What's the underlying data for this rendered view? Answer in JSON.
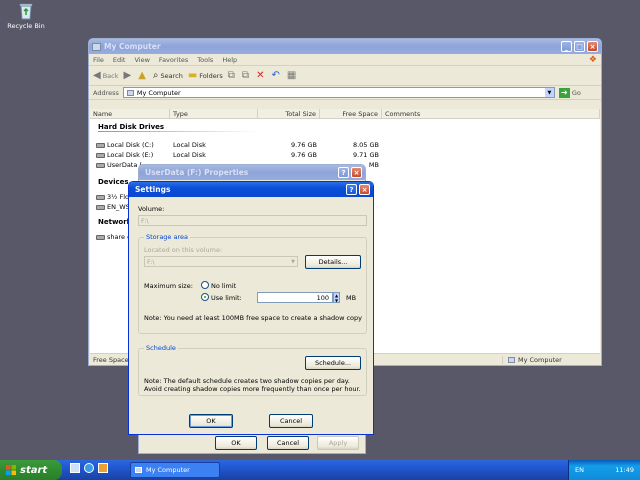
{
  "desktop": {
    "recycle_bin_label": "Recycle Bin"
  },
  "explorer": {
    "title": "My Computer",
    "menu": [
      "File",
      "Edit",
      "View",
      "Favorites",
      "Tools",
      "Help"
    ],
    "toolbar": {
      "back": "Back",
      "search": "Search",
      "folders": "Folders"
    },
    "address_label": "Address",
    "address_value": "My Computer",
    "go_label": "Go",
    "columns": [
      "Name",
      "Type",
      "Total Size",
      "Free Space",
      "Comments"
    ],
    "groups": {
      "hard_disks": "Hard Disk Drives",
      "devices": "Devices",
      "network": "Network"
    },
    "drives": [
      {
        "name": "Local Disk (C:)",
        "type": "Local Disk",
        "total": "9.76 GB",
        "free": "8.05 GB"
      },
      {
        "name": "Local Disk (E:)",
        "type": "Local Disk",
        "total": "9.76 GB",
        "free": "9.71 GB"
      },
      {
        "name": "UserData (",
        "type": "",
        "total": "",
        "free": "MB"
      }
    ],
    "devices": [
      "3½ Flo",
      "EN_WS"
    ],
    "network": [
      "share o"
    ],
    "status_left": "Free Space:",
    "status_right": "My Computer"
  },
  "properties": {
    "title": "UserData (F:) Properties",
    "ok": "OK",
    "cancel": "Cancel",
    "apply": "Apply"
  },
  "settings": {
    "title": "Settings",
    "volume_label": "Volume:",
    "volume_value": "F:\\",
    "storage_legend": "Storage area",
    "located_label": "Located on this volume:",
    "located_value": "F:\\",
    "details_button": "Details...",
    "max_size_label": "Maximum size:",
    "no_limit_label": "No limit",
    "use_limit_label": "Use limit:",
    "limit_value": "100",
    "limit_unit": "MB",
    "note_storage": "Note: You need at least 100MB free space to create a shadow copy",
    "schedule_legend": "Schedule",
    "schedule_button": "Schedule...",
    "note_schedule": "Note: The default schedule creates two shadow copies per day. Avoid creating shadow copies more frequently than once per hour.",
    "ok": "OK",
    "cancel": "Cancel"
  },
  "taskbar": {
    "start": "start",
    "task_item": "My Computer",
    "lang": "EN",
    "clock": "11:49"
  }
}
